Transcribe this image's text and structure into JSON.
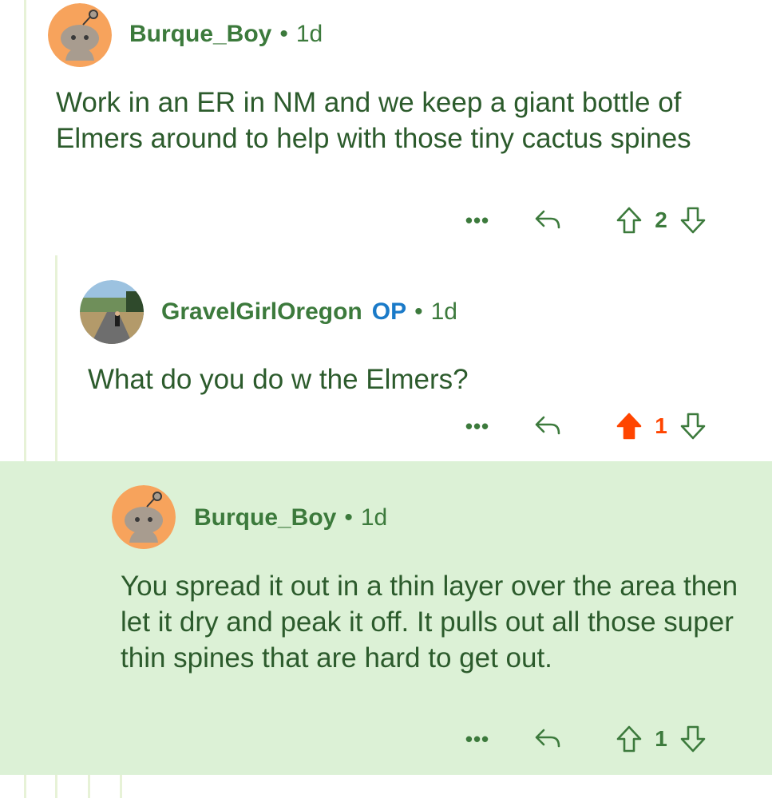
{
  "comments": [
    {
      "author": "Burque_Boy",
      "separator": "•",
      "age": "1d",
      "body": "Work in an ER in NM and we keep a giant bottle of Elmers around to help with those tiny cactus spines",
      "score": "2",
      "voted": "none",
      "more_label": "•••"
    },
    {
      "author": "GravelGirlOregon",
      "op_badge": "OP",
      "separator": "•",
      "age": "1d",
      "body": "What do you do w the Elmers?",
      "score": "1",
      "voted": "up",
      "more_label": "•••"
    },
    {
      "author": "Burque_Boy",
      "separator": "•",
      "age": "1d",
      "body": "You spread it out in a thin layer over the area then let it dry and peak it off. It pulls out all those super thin spines that are hard to get out.",
      "score": "1",
      "voted": "none",
      "more_label": "•••",
      "highlighted": true
    }
  ],
  "colors": {
    "text": "#2c5b2c",
    "author": "#3c7a3c",
    "op": "#1a7ac8",
    "upvote_active": "#ff4500",
    "highlight": "#dcf1d6",
    "avatar_bg": "#f7a35c"
  },
  "icons": [
    "snoo-avatar-icon",
    "more-options-icon",
    "reply-icon",
    "upvote-icon",
    "downvote-icon"
  ]
}
